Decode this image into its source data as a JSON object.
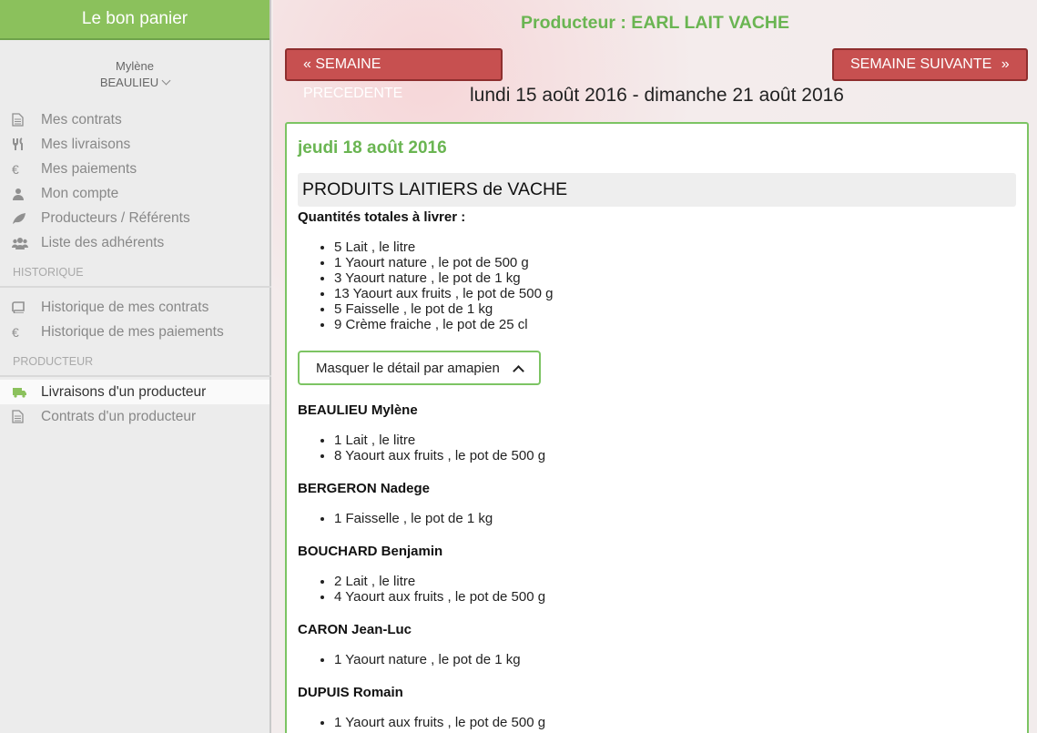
{
  "sidebar": {
    "brand": "Le bon panier",
    "user_first": "Mylène",
    "user_last": "BEAULIEU",
    "menu": [
      {
        "label": "Mes contrats",
        "icon": "file-icon"
      },
      {
        "label": "Mes livraisons",
        "icon": "cutlery-icon"
      },
      {
        "label": "Mes paiements",
        "icon": "euro-icon"
      },
      {
        "label": "Mon compte",
        "icon": "user-icon"
      },
      {
        "label": "Producteurs / Référents",
        "icon": "leaf-icon"
      },
      {
        "label": "Liste des adhérents",
        "icon": "users-icon"
      }
    ],
    "historique_label": "HISTORIQUE",
    "historique": [
      {
        "label": "Historique de mes contrats",
        "icon": "book-icon"
      },
      {
        "label": "Historique de mes paiements",
        "icon": "euro-icon"
      }
    ],
    "producteur_label": "PRODUCTEUR",
    "producteur": [
      {
        "label": "Livraisons d'un producteur",
        "icon": "truck-icon"
      },
      {
        "label": "Contrats d'un producteur",
        "icon": "file-icon"
      }
    ]
  },
  "header": {
    "producer": "Producteur : EARL LAIT VACHE",
    "prev_label": "SEMAINE PRECEDENTE",
    "next_label": "SEMAINE SUIVANTE",
    "week": "lundi 15 août 2016 - dimanche 21 août 2016"
  },
  "delivery": {
    "date": "jeudi 18 août 2016",
    "product_title": "PRODUITS LAITIERS de VACHE",
    "totals_label": "Quantités totales à livrer :",
    "totals": [
      "5 Lait , le litre",
      "1 Yaourt nature , le pot de 500 g",
      "3 Yaourt nature , le pot de 1 kg",
      "13 Yaourt aux fruits , le pot de 500 g",
      "5 Faisselle , le pot de 1 kg",
      "9 Crème fraiche , le pot de 25 cl"
    ],
    "toggle_label": "Masquer le détail par amapien",
    "members": [
      {
        "name": "BEAULIEU Mylène",
        "items": [
          "1 Lait , le litre",
          "8 Yaourt aux fruits , le pot de 500 g"
        ]
      },
      {
        "name": "BERGERON Nadege",
        "items": [
          "1 Faisselle , le pot de 1 kg"
        ]
      },
      {
        "name": "BOUCHARD Benjamin",
        "items": [
          "2 Lait , le litre",
          "4 Yaourt aux fruits , le pot de 500 g"
        ]
      },
      {
        "name": "CARON Jean-Luc",
        "items": [
          "1 Yaourt nature , le pot de 1 kg"
        ]
      },
      {
        "name": "DUPUIS Romain",
        "items": [
          "1 Yaourt aux fruits , le pot de 500 g"
        ]
      }
    ]
  }
}
